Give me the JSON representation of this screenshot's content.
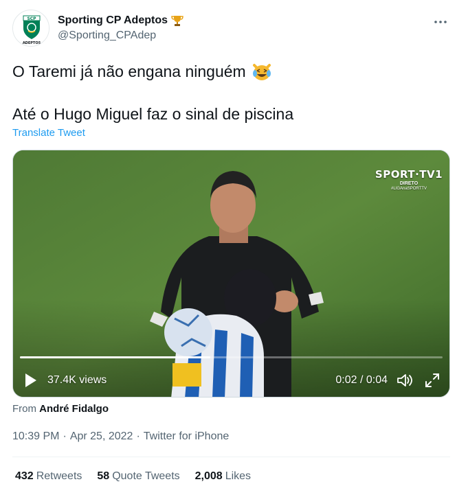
{
  "author": {
    "display_name": "Sporting CP Adeptos",
    "handle": "@Sporting_CPAdep",
    "badge_icon": "trophy-emoji",
    "avatar_text_top": "SCP",
    "avatar_text_bottom": "ADEPTOS"
  },
  "more_icon": "more-horizontal-icon",
  "tweet": {
    "line1": "O Taremi já não engana ninguém",
    "line1_emoji": "laughing-crying-cat-emoji",
    "line2": "Até o Hugo Miguel faz o sinal de piscina",
    "translate_label": "Translate Tweet"
  },
  "video": {
    "broadcaster": "SPORT·TV1",
    "live_label": "DIRETO",
    "hashtag": "#LIGAnaSPORTTV",
    "views": "37.4K views",
    "time": "0:02 / 0:04",
    "progress": 0.45,
    "play_icon": "play-icon",
    "volume_icon": "volume-icon",
    "fullscreen_icon": "fullscreen-icon"
  },
  "from": {
    "prefix": "From",
    "source_name": "André Fidalgo"
  },
  "meta": {
    "time": "10:39 PM",
    "date": "Apr 25, 2022",
    "client": "Twitter for iPhone",
    "separator": "·"
  },
  "stats": {
    "retweets_count": "432",
    "retweets_label": "Retweets",
    "quotes_count": "58",
    "quotes_label": "Quote Tweets",
    "likes_count": "2,008",
    "likes_label": "Likes"
  },
  "colors": {
    "accent": "#1d9bf0",
    "text_primary": "#0f1419",
    "text_secondary": "#536471",
    "sporting_green": "#008057"
  }
}
